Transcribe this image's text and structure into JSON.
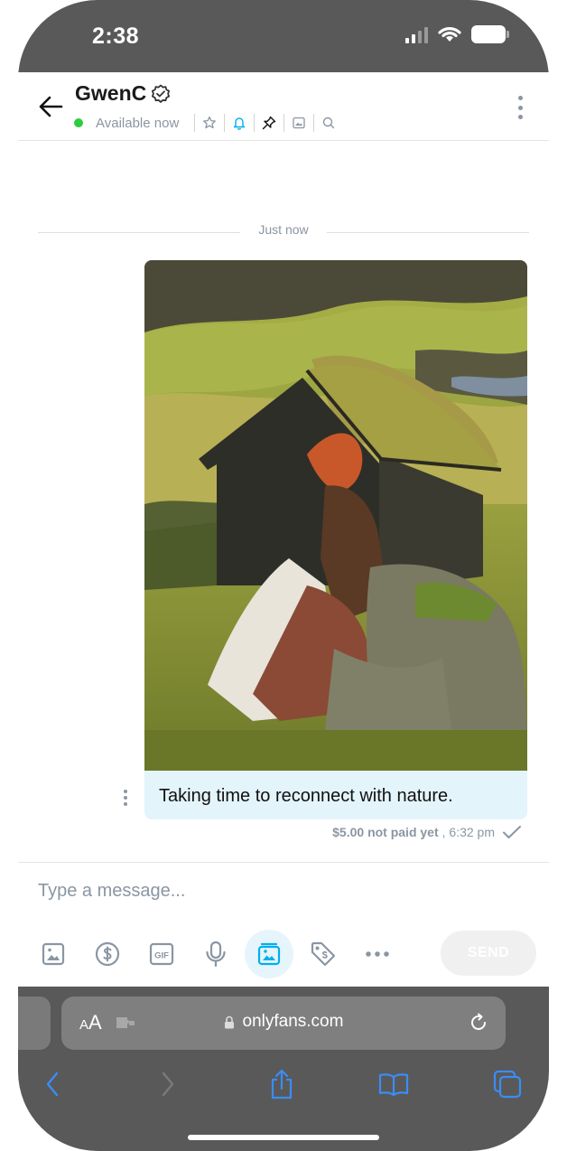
{
  "status_bar": {
    "time": "2:38"
  },
  "header": {
    "name": "GwenC",
    "status": "Available now",
    "icons": [
      "star-icon",
      "bell-icon",
      "pin-icon",
      "gallery-icon",
      "search-icon"
    ]
  },
  "chat": {
    "date_label": "Just now",
    "message": {
      "text": "Taking time to reconnect with nature.",
      "price_status": "$5.00 not paid yet",
      "time": ", 6:32 pm"
    }
  },
  "composer": {
    "placeholder": "Type a message...",
    "gif_label": "GIF",
    "send_label": "SEND",
    "tools": [
      "image-icon",
      "dollar-icon",
      "gif-icon",
      "microphone-icon",
      "vault-media-icon",
      "price-tag-icon",
      "more-icon"
    ]
  },
  "browser": {
    "aa_big": "A",
    "aa_small": "A",
    "url": "onlyfans.com"
  },
  "colors": {
    "accent": "#00aff0",
    "muted": "#8a96a3",
    "bubble": "#e4f4fb",
    "online": "#2ecc40",
    "safari_blue": "#3b8cf5"
  }
}
